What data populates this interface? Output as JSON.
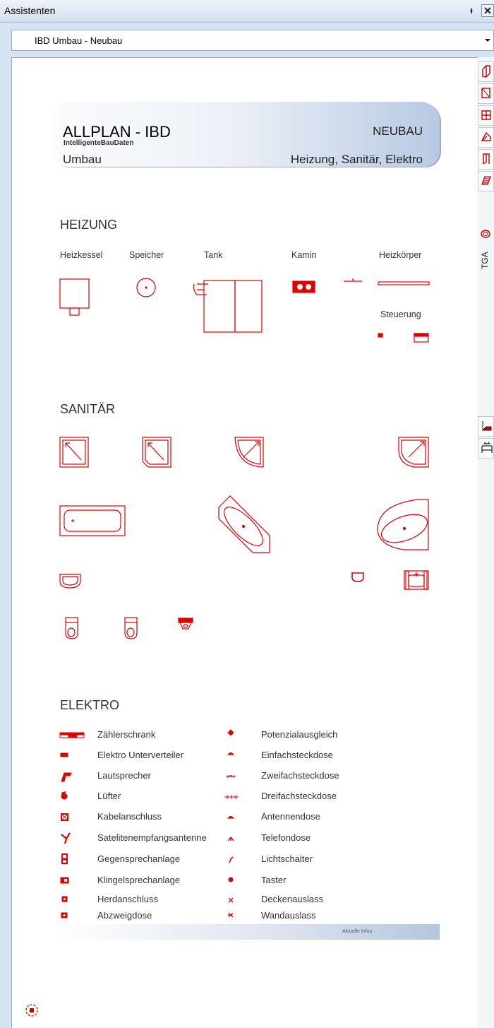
{
  "window": {
    "title": "Assistenten",
    "pin_glyph": "ᵻ"
  },
  "selector": {
    "value": "IBD Umbau - Neubau"
  },
  "sidebar": {
    "tabs": [
      "wall-icon",
      "window-icon",
      "stair-icon",
      "roof-icon",
      "door-icon",
      "layers-icon",
      "tga-icon",
      "dimension-icon",
      "measure-icon"
    ],
    "tga_label": "TGA"
  },
  "banner": {
    "title": "ALLPLAN - IBD",
    "subtitle": "IntelligenteBauDaten",
    "left_sub": "Umbau",
    "right_title": "NEUBAU",
    "right_sub": "Heizung, Sanitär, Elektro"
  },
  "heizung": {
    "heading": "HEIZUNG",
    "labels": [
      "Heizkessel",
      "Speicher",
      "Tank",
      "Kamin",
      "Heizkörper"
    ],
    "steuerung": "Steuerung"
  },
  "sanitaer": {
    "heading": "SANITÄR"
  },
  "elektro": {
    "heading": "ELEKTRO",
    "left": [
      "Zählerschrank",
      "Elektro Unterverteiler",
      "Lautsprecher",
      "Lüfter",
      "Kabelanschluss",
      "Satelitenempfangsantenne",
      "Gegensprechanlage",
      "Klingelsprechanlage",
      "Herdanschluss",
      "Abzweigdose"
    ],
    "right": [
      "Potenzialausgleich",
      "Einfachsteckdose",
      "Zweifachsteckdose",
      "Dreifachsteckdose",
      "Antennendose",
      "Telefondose",
      "Lichtschalter",
      "Taster",
      "Deckenauslass",
      "Wandauslass"
    ]
  },
  "footer": {
    "info": "Aktuelle Infos"
  },
  "colors": {
    "symbol": "#e00000",
    "accent": "#b7c9e3",
    "frame": "#d6e3f2"
  }
}
